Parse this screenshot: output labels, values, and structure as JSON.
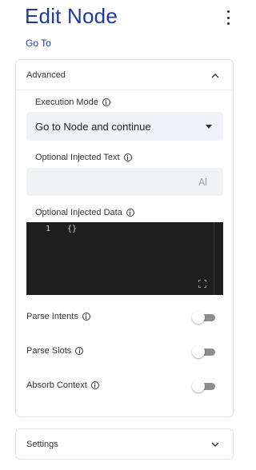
{
  "header": {
    "title": "Edit Node",
    "subtitle": "Go To",
    "menu_icon": "kebab-menu-icon"
  },
  "advanced": {
    "label": "Advanced",
    "expanded": true,
    "execution_mode": {
      "label": "Execution Mode",
      "value": "Go to Node and continue"
    },
    "injected_text": {
      "label": "Optional Injected Text",
      "value": "",
      "icon": "ai-icon"
    },
    "injected_data": {
      "label": "Optional Injected Data",
      "line_number": "1",
      "code": "{}"
    },
    "toggles": [
      {
        "label": "Parse Intents",
        "on": false
      },
      {
        "label": "Parse Slots",
        "on": false
      },
      {
        "label": "Absorb Context",
        "on": false
      }
    ]
  },
  "settings": {
    "label": "Settings",
    "expanded": false
  },
  "colors": {
    "accent": "#1f3a9e",
    "select_bg": "#f1f2f8",
    "editor_bg": "#1e1e1e",
    "toggle_track": "#8d8d8d"
  }
}
